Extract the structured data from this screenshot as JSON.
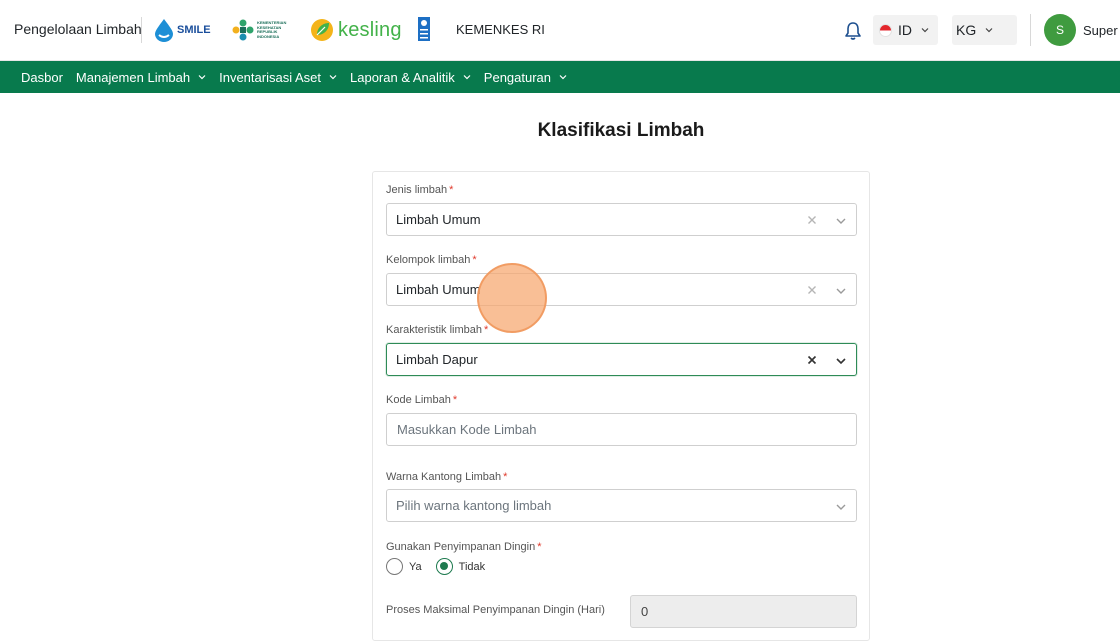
{
  "header": {
    "app_title": "Pengelolaan Limbah",
    "logos": {
      "smile": "SMILE",
      "smile_sub": "",
      "kemkes": "KEMENTERIAN KESEHATAN REPUBLIK INDONESIA",
      "kesling": "kesling"
    },
    "org_name": "KEMENKES RI",
    "language": "ID",
    "unit": "KG",
    "user_initial": "S",
    "user_name": "Super A"
  },
  "nav": {
    "items": [
      {
        "label": "Dasbor",
        "has_dropdown": false
      },
      {
        "label": "Manajemen Limbah",
        "has_dropdown": true
      },
      {
        "label": "Inventarisasi Aset",
        "has_dropdown": true
      },
      {
        "label": "Laporan & Analitik",
        "has_dropdown": true
      },
      {
        "label": "Pengaturan",
        "has_dropdown": true
      }
    ]
  },
  "page": {
    "title": "Klasifikasi Limbah"
  },
  "form": {
    "jenis": {
      "label": "Jenis limbah",
      "required": "*",
      "value": "Limbah Umum"
    },
    "kelompok": {
      "label": "Kelompok limbah",
      "required": "*",
      "value": "Limbah Umum"
    },
    "karakteristik": {
      "label": "Karakteristik limbah",
      "required": "*",
      "value": "Limbah Dapur"
    },
    "kode": {
      "label": "Kode Limbah",
      "required": "*",
      "value": "",
      "placeholder": "Masukkan Kode Limbah"
    },
    "warna": {
      "label": "Warna Kantong Limbah",
      "required": "*",
      "placeholder": "Pilih warna kantong limbah"
    },
    "dingin": {
      "label": "Gunakan Penyimpanan Dingin",
      "required": "*",
      "options": [
        "Ya",
        "Tidak"
      ],
      "selected": "Tidak"
    },
    "proses": {
      "label": "Proses Maksimal Penyimpanan Dingin (Hari)",
      "value": "0"
    }
  },
  "colors": {
    "nav_bg": "#087a4d",
    "accent": "#1e7a4f",
    "required": "#e0392b",
    "avatar": "#3f9b3f",
    "kesling_green": "#43b24a"
  }
}
